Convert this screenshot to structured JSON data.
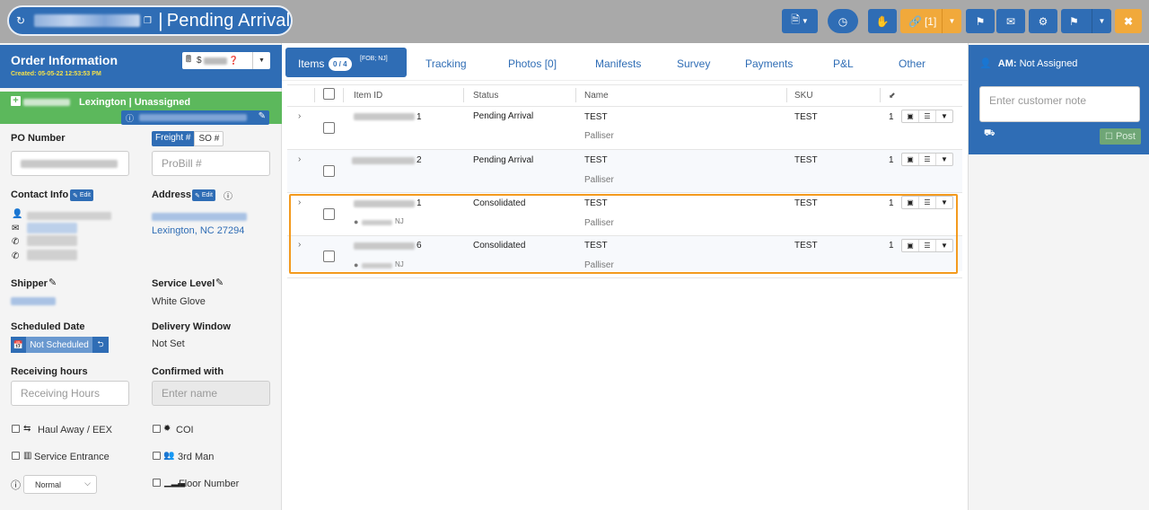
{
  "header": {
    "title": "Pending Arrival",
    "separator": "|",
    "action_counts": {
      "link": "[1]"
    },
    "icons": [
      "refresh-icon",
      "copy-icon",
      "document-icon",
      "clock-icon",
      "hand-icon",
      "link-icon",
      "flag-icon",
      "envelope-icon",
      "gear-icon",
      "flag-check-icon",
      "close-icon"
    ]
  },
  "order": {
    "section_title": "Order Information",
    "created": "Created: 05-05-22 12:53:53 PM",
    "currency_symbol": "$",
    "location": "Lexington | Unassigned",
    "po_label": "PO Number",
    "freight_label": "Freight #",
    "so_label": "SO #",
    "probill_placeholder": "ProBill #",
    "contact_label": "Contact Info",
    "edit_label": "Edit",
    "address_label": "Address",
    "address_city": "Lexington, NC 27294",
    "shipper_label": "Shipper",
    "service_level_label": "Service Level",
    "service_level": "White Glove",
    "scheduled_date_label": "Scheduled Date",
    "scheduled_value": "Not Scheduled",
    "delivery_window_label": "Delivery Window",
    "delivery_window": "Not Set",
    "receiving_hours_label": "Receiving hours",
    "receiving_hours_placeholder": "Receiving Hours",
    "confirmed_with_label": "Confirmed with",
    "confirmed_placeholder": "Enter name",
    "haul_away": "Haul Away / EEX",
    "coi": "COI",
    "service_entrance": "Service Entrance",
    "third_man": "3rd Man",
    "priority": "Normal",
    "floor_number": "Floor Number"
  },
  "tabs": {
    "items": "Items",
    "items_count": "0 / 4",
    "items_fob": "[FOB; NJ]",
    "tracking": "Tracking",
    "photos": "Photos [0]",
    "manifests": "Manifests",
    "survey": "Survey",
    "payments": "Payments",
    "pl": "P&L",
    "other": "Other"
  },
  "table": {
    "headers": {
      "item_id": "Item ID",
      "status": "Status",
      "name": "Name",
      "sku": "SKU"
    },
    "rows": [
      {
        "id_suffix": "1",
        "status": "Pending Arrival",
        "name": "TEST",
        "vendor": "Palliser",
        "sku": "TEST",
        "qty": "1",
        "location": ""
      },
      {
        "id_suffix": "2",
        "status": "Pending Arrival",
        "name": "TEST",
        "vendor": "Palliser",
        "sku": "TEST",
        "qty": "1",
        "location": ""
      },
      {
        "id_suffix": "1",
        "status": "Consolidated",
        "name": "TEST",
        "vendor": "Palliser",
        "sku": "TEST",
        "qty": "1",
        "location": "NJ"
      },
      {
        "id_suffix": "6",
        "status": "Consolidated",
        "name": "TEST",
        "vendor": "Palliser",
        "sku": "TEST",
        "qty": "1",
        "location": "NJ"
      }
    ]
  },
  "right_panel": {
    "am_label": "AM:",
    "am_value": "Not Assigned",
    "note_placeholder": "Enter customer note",
    "post_label": "Post"
  },
  "colors": {
    "primary": "#2f6db5",
    "accent": "#f1a93b",
    "success": "#5cb85c",
    "highlight": "#f39a1e"
  }
}
